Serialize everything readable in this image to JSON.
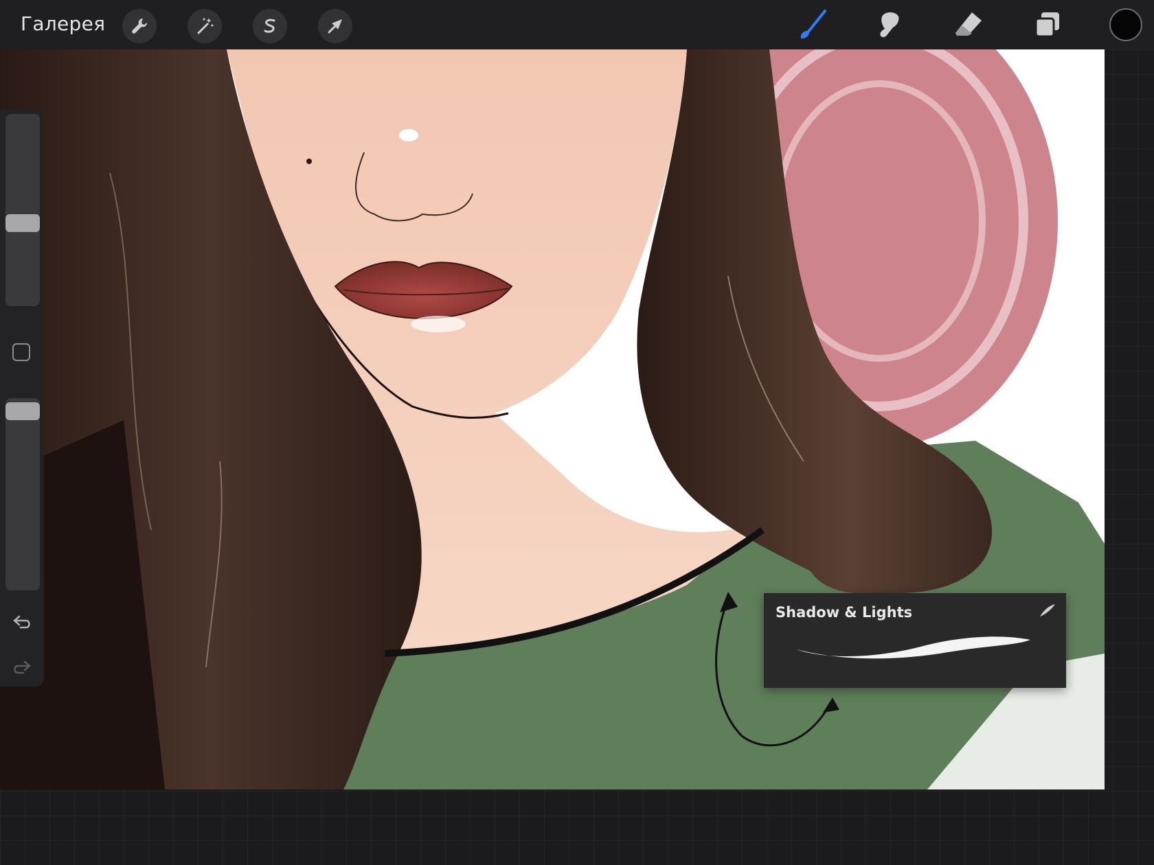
{
  "app": {
    "gallery_label": "Галерея"
  },
  "toolbar": {
    "left_tools": [
      {
        "name": "actions",
        "icon": "wrench-icon"
      },
      {
        "name": "adjustments",
        "icon": "magic-wand-icon"
      },
      {
        "name": "selection",
        "icon": "selection-s-icon"
      },
      {
        "name": "transform",
        "icon": "arrow-cursor-icon"
      }
    ],
    "right_tools": [
      {
        "name": "brush",
        "icon": "brush-icon",
        "active": true
      },
      {
        "name": "smudge",
        "icon": "smudge-finger-icon"
      },
      {
        "name": "eraser",
        "icon": "eraser-icon"
      },
      {
        "name": "layers",
        "icon": "layers-icon"
      }
    ],
    "current_color": "#050505",
    "accent_color": "#2f7cf6"
  },
  "sidebar": {
    "brush_size_level": 0.54,
    "opacity_level": 1.0,
    "undo_icon": "undo-arrow-icon",
    "redo_icon": "redo-arrow-icon"
  },
  "brush_popup": {
    "name": "Shadow & Lights"
  }
}
